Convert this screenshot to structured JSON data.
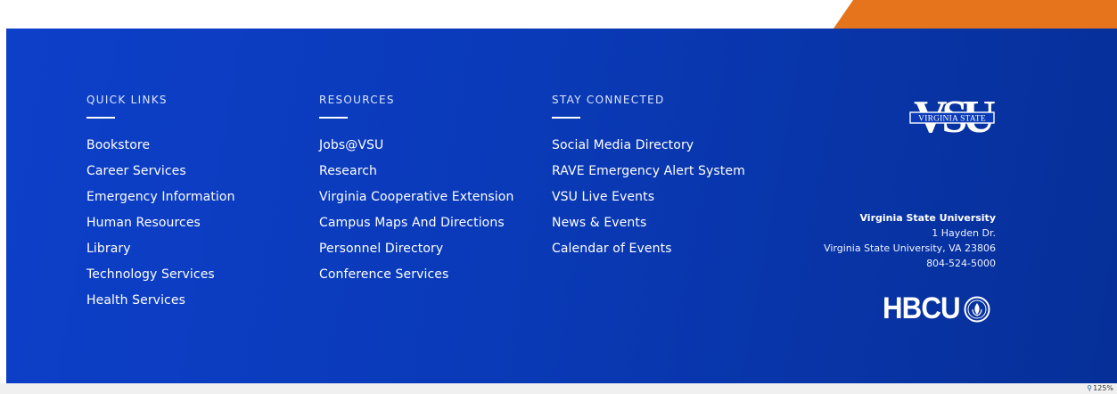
{
  "colors": {
    "footer_blue": "#0a3ab8",
    "accent_orange": "#e5741d",
    "text": "#ffffff"
  },
  "quick_links": {
    "heading": "QUICK LINKS",
    "items": [
      "Bookstore",
      "Career Services",
      "Emergency Information",
      "Human Resources",
      "Library",
      "Technology Services",
      "Health Services"
    ]
  },
  "resources": {
    "heading": "RESOURCES",
    "items": [
      "Jobs@VSU",
      "Research",
      "Virginia Cooperative Extension",
      "Campus Maps And Directions",
      "Personnel Directory",
      "Conference Services"
    ]
  },
  "stay_connected": {
    "heading": "STAY CONNECTED",
    "items": [
      "Social Media Directory",
      "RAVE Emergency Alert System",
      "VSU Live Events",
      "News & Events",
      "Calendar of Events"
    ]
  },
  "logo": {
    "monogram": "VSU",
    "banner": "VIRGINIA STATE"
  },
  "address": {
    "university": "Virginia State University",
    "street": "1 Hayden Dr.",
    "city": "Virginia State University, VA 23806",
    "phone": "804-524-5000"
  },
  "hbcu": {
    "label": "HBCU",
    "icon": "hbcu-seal-icon"
  },
  "status": {
    "zoom": "125%",
    "icon": "magnifier-icon"
  }
}
